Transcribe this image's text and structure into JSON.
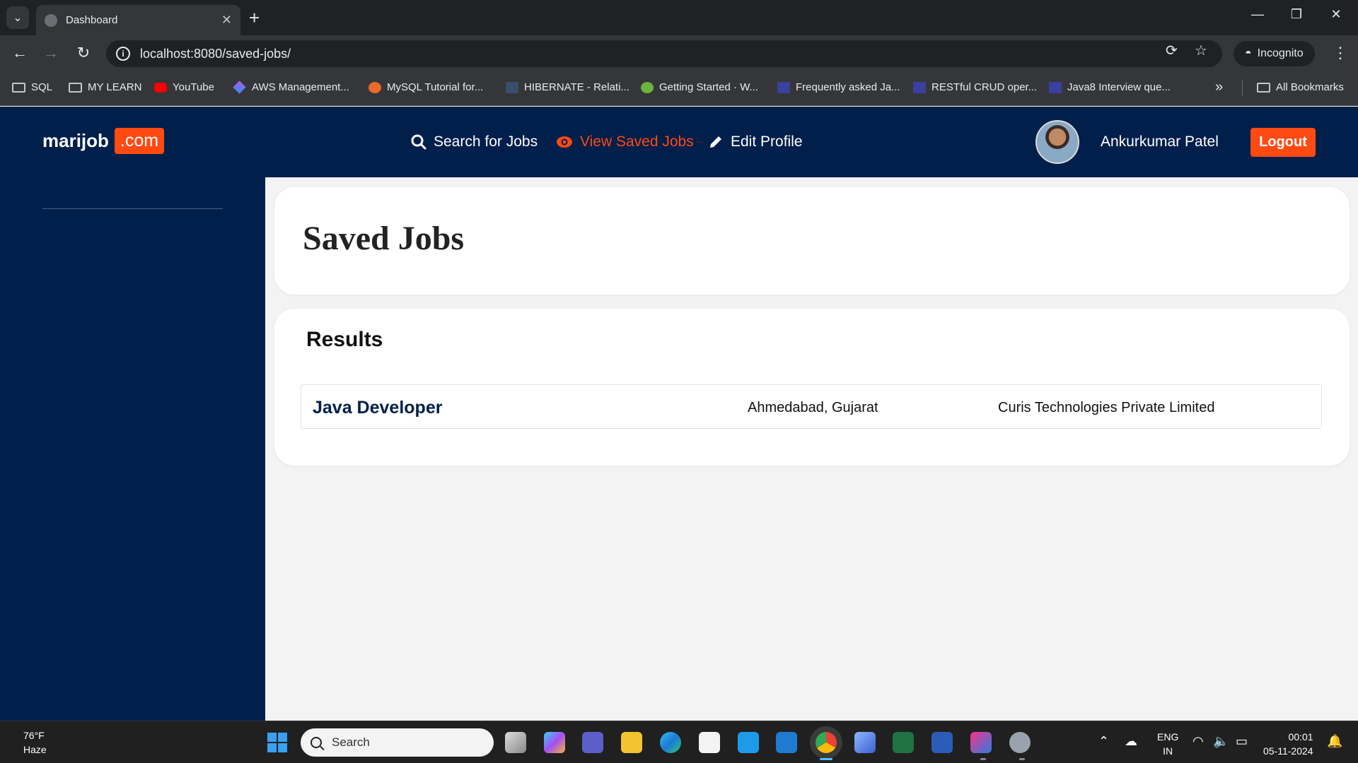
{
  "browser": {
    "tab_title": "Dashboard",
    "url": "localhost:8080/saved-jobs/",
    "incognito_label": "Incognito",
    "bookmarks": [
      {
        "label": "SQL",
        "icon": "folder-icon"
      },
      {
        "label": "MY LEARN",
        "icon": "folder-icon"
      },
      {
        "label": "YouTube",
        "icon": "youtube-icon"
      },
      {
        "label": "AWS Management...",
        "icon": "aws-icon"
      },
      {
        "label": "MySQL Tutorial for...",
        "icon": "mysql-icon"
      },
      {
        "label": "HIBERNATE - Relati...",
        "icon": "hibernate-icon"
      },
      {
        "label": "Getting Started · W...",
        "icon": "spring-icon"
      },
      {
        "label": "Frequently asked Ja...",
        "icon": "java-icon"
      },
      {
        "label": "RESTful CRUD oper...",
        "icon": "java-icon"
      },
      {
        "label": "Java8 Interview que...",
        "icon": "java-icon"
      }
    ],
    "all_bookmarks_label": "All Bookmarks"
  },
  "app": {
    "logo_text": "marijob",
    "logo_suffix": ".com",
    "nav": {
      "search_jobs": "Search for Jobs",
      "saved_jobs": "View Saved Jobs",
      "edit_profile": "Edit Profile"
    },
    "user_name": "Ankurkumar Patel",
    "logout_label": "Logout",
    "accent_color": "#ff4a12",
    "brand_color": "#011f4b"
  },
  "page": {
    "title": "Saved Jobs",
    "results_heading": "Results",
    "jobs": [
      {
        "title": "Java Developer",
        "location": "Ahmedabad, Gujarat",
        "company": "Curis Technologies Private Limited"
      }
    ]
  },
  "taskbar": {
    "weather_temp": "76°F",
    "weather_desc": "Haze",
    "search_label": "Search",
    "lang_1": "ENG",
    "lang_2": "IN",
    "time": "00:01",
    "date": "05-11-2024"
  }
}
